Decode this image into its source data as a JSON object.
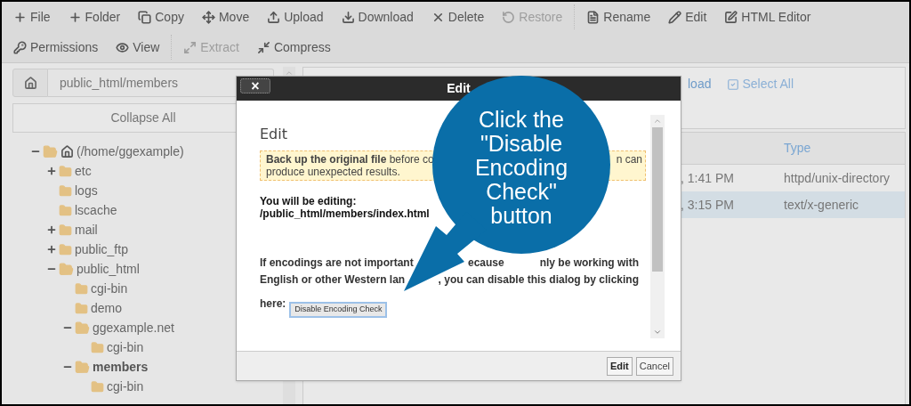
{
  "toolbar": {
    "rows": [
      {
        "groups": [
          [
            {
              "label": "File",
              "disabled": false
            },
            {
              "label": "Folder",
              "disabled": false
            },
            {
              "label": "Copy",
              "disabled": false
            },
            {
              "label": "Move",
              "disabled": false
            },
            {
              "label": "Upload",
              "disabled": false
            },
            {
              "label": "Download",
              "disabled": false
            },
            {
              "label": "Delete",
              "disabled": false
            },
            {
              "label": "Restore",
              "disabled": true
            }
          ],
          [
            {
              "label": "Rename",
              "disabled": false
            },
            {
              "label": "Edit",
              "disabled": false
            },
            {
              "label": "HTML Editor",
              "disabled": false
            }
          ]
        ]
      },
      {
        "groups": [
          [
            {
              "label": "Permissions",
              "disabled": false
            },
            {
              "label": "View",
              "disabled": false
            }
          ],
          [
            {
              "label": "Extract",
              "disabled": true
            },
            {
              "label": "Compress",
              "disabled": false
            }
          ]
        ]
      }
    ]
  },
  "sidebar": {
    "path": "public_html/members",
    "collapse_button": "Collapse All",
    "tree": [
      {
        "label": "(/home/ggexample)",
        "expanded": true,
        "selected": false,
        "children": [
          {
            "label": "etc",
            "expanded": false,
            "selected": false
          },
          {
            "label": "logs",
            "selected": false
          },
          {
            "label": "lscache",
            "selected": false
          },
          {
            "label": "mail",
            "expanded": false,
            "selected": false
          },
          {
            "label": "public_ftp",
            "expanded": false,
            "selected": false
          },
          {
            "label": "public_html",
            "expanded": true,
            "selected": false,
            "children": [
              {
                "label": "cgi-bin",
                "selected": false
              },
              {
                "label": "demo",
                "selected": false
              },
              {
                "label": "ggexample.net",
                "expanded": true,
                "selected": false,
                "children": [
                  {
                    "label": "cgi-bin",
                    "selected": false
                  }
                ]
              },
              {
                "label": "members",
                "expanded": true,
                "selected": true,
                "children": [
                  {
                    "label": "cgi-bin",
                    "selected": false
                  }
                ]
              }
            ]
          }
        ]
      }
    ]
  },
  "file_list": {
    "actions": [
      {
        "label": "load",
        "kind": "link"
      },
      {
        "label": "Select All",
        "kind": "checkbox"
      }
    ],
    "columns": [
      "Type"
    ],
    "rows": [
      {
        "modified": ", 1:41 PM",
        "type": "httpd/unix-directory",
        "selected": false
      },
      {
        "modified": ", 3:15 PM",
        "type": "text/x-generic",
        "selected": true
      }
    ]
  },
  "dialog": {
    "title": "Edit",
    "close": "×",
    "heading": "Edit",
    "warning": {
      "line_1": [
        "**Back up the original file** before co",
        "n can"
      ],
      "line_2": "produce unexpected results."
    },
    "editing_label": "You will be editing:",
    "editing_path": "/public_html/members/index.html",
    "paragraph_lines": [
      [
        "If encodings are not important",
        "ecause",
        "nly be working with"
      ],
      [
        "English or other Western lan",
        ", you can disable this dialog by clicking"
      ]
    ],
    "here_label": "here:",
    "disable_button": "Disable Encoding Check",
    "buttons": [
      {
        "label": "Edit",
        "primary": true
      },
      {
        "label": "Cancel",
        "primary": false
      }
    ]
  },
  "callout": {
    "text": "Click the \"Disable Encoding Check\" button"
  }
}
